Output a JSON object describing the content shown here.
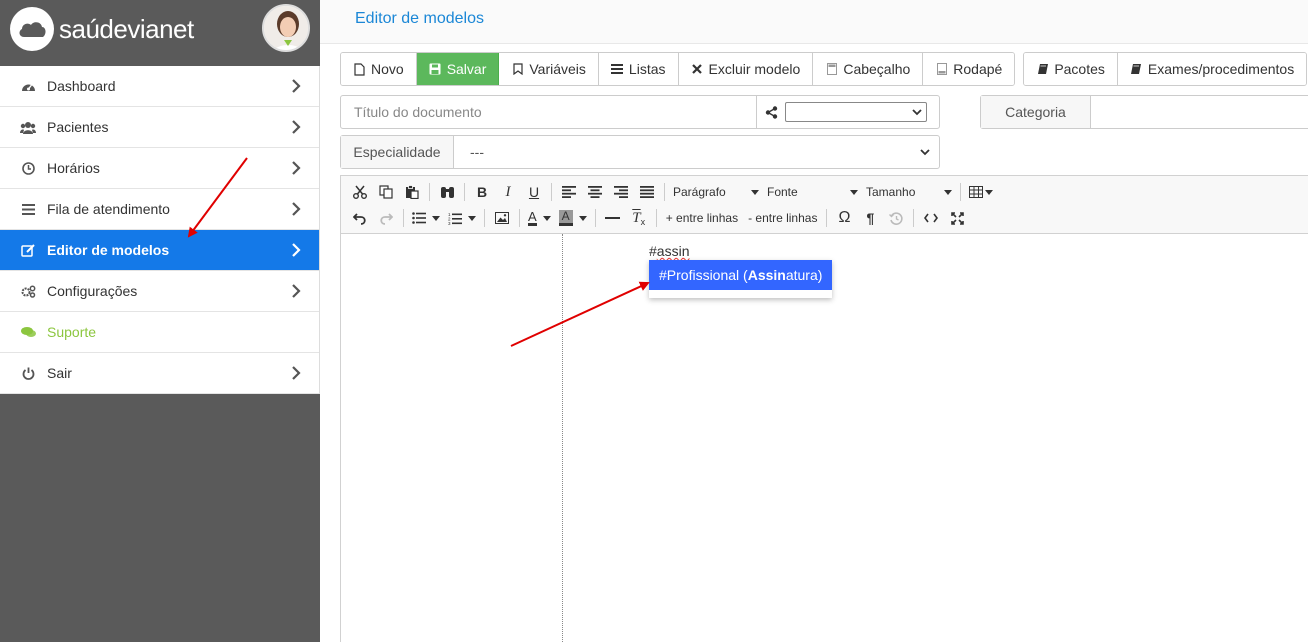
{
  "brand": {
    "name": "saúdevianet",
    "logo_icon": "cloud-logo-icon",
    "avatar": "user-avatar"
  },
  "sidebar": {
    "items": [
      {
        "label": "Dashboard",
        "icon": "dashboard-icon"
      },
      {
        "label": "Pacientes",
        "icon": "users-icon"
      },
      {
        "label": "Horários",
        "icon": "clock-icon"
      },
      {
        "label": "Fila de atendimento",
        "icon": "list-icon"
      },
      {
        "label": "Editor de modelos",
        "icon": "edit-icon",
        "active": true
      },
      {
        "label": "Configurações",
        "icon": "cogs-icon"
      },
      {
        "label": "Suporte",
        "icon": "chat-icon"
      },
      {
        "label": "Sair",
        "icon": "power-icon"
      }
    ]
  },
  "page": {
    "title": "Editor de modelos"
  },
  "toolbar": {
    "novo": "Novo",
    "salvar": "Salvar",
    "variaveis": "Variáveis",
    "listas": "Listas",
    "excluir": "Excluir modelo",
    "cabecalho": "Cabeçalho",
    "rodape": "Rodapé",
    "pacotes": "Pacotes",
    "exames": "Exames/procedimentos"
  },
  "form": {
    "title_placeholder": "Título do documento",
    "share_value": "",
    "category_label": "Categoria",
    "specialty_label": "Especialidade",
    "specialty_value": "---"
  },
  "editor": {
    "paragraph": "Parágrafo",
    "font": "Fonte",
    "size": "Tamanho",
    "increase_lines": "+ entre linhas",
    "decrease_lines": "- entre linhas",
    "typed_prefix": "#",
    "typed_word": "assin",
    "autocomplete": {
      "pre": "#Profissional (",
      "match": "Assin",
      "post": "atura)"
    }
  },
  "colors": {
    "sidebar_bg": "#5a5a5a",
    "active_item": "#1479e8",
    "save_btn": "#5cb85c",
    "support_text": "#8cc63f",
    "title_blue": "#1b87d6",
    "autocomplete_bg": "#3366ff",
    "arrow": "#e00000"
  }
}
